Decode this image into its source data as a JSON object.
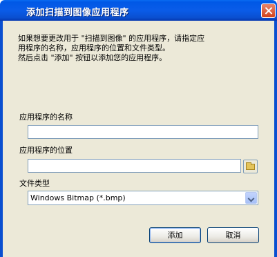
{
  "window": {
    "title": "添加扫描到图像应用程序"
  },
  "description": {
    "lines": [
      "如果想要更改用于 \"扫描到图像\" 的应用程序，请指定应",
      "用程序的名称，应用程序的位置和文件类型。",
      "然后点击 \"添加\" 按钮以添加您的应用程序。"
    ]
  },
  "form": {
    "app_name_label": "应用程序的名称",
    "app_name_value": "",
    "app_location_label": "应用程序的位置",
    "app_location_value": "",
    "file_type_label": "文件类型",
    "file_type_selected": "Windows Bitmap (*.bmp)"
  },
  "buttons": {
    "add_label": "添加",
    "cancel_label": "取消"
  },
  "icons": {
    "close": "close-icon",
    "browse": "folder-icon",
    "dropdown": "chevron-down-icon"
  },
  "colors": {
    "titlebar": "#0a5ce8",
    "dialog_background": "#ece9d8",
    "close_button": "#d2421c",
    "input_border": "#7f9db9"
  }
}
